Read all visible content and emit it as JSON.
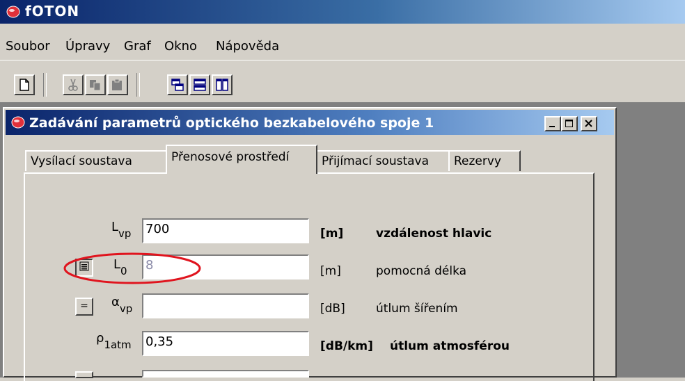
{
  "app": {
    "title": "fOTON"
  },
  "menu": [
    "Soubor",
    "Úpravy",
    "Graf",
    "Okno",
    "Nápověda"
  ],
  "toolbar": {
    "buttons": [
      "new-document-icon",
      "cut-icon",
      "copy-icon",
      "paste-icon",
      "cascade-windows-icon",
      "tile-horizontal-icon",
      "tile-vertical-icon"
    ]
  },
  "dialog": {
    "title": "Zadávání parametrů optického bezkabelového spoje 1",
    "tabs": [
      "Vysílací soustava",
      "Přenosové prostředí",
      "Přijímací soustava",
      "Rezervy"
    ],
    "active_tab": "Přenosové prostředí",
    "rows": [
      {
        "symbol": "L",
        "subscript": "vp",
        "value": "700",
        "unit": "[m]",
        "description": "vzdálenost hlavic",
        "bold": true
      },
      {
        "symbol": "L",
        "subscript": "0",
        "value": "8",
        "unit": "[m]",
        "description": "pomocná délka",
        "bold": false
      },
      {
        "symbol": "α",
        "subscript": "vp",
        "value": "",
        "unit": "[dB]",
        "description": "útlum šířením",
        "bold": false
      },
      {
        "symbol": "ρ",
        "subscript": "1atm",
        "value": "0,35",
        "unit": "[dB/km]",
        "description": "útlum atmosférou",
        "bold": true
      }
    ],
    "equals_button": "="
  },
  "colors": {
    "highlight_ellipse": "#e0141e",
    "title_bar": "#0a246a"
  }
}
